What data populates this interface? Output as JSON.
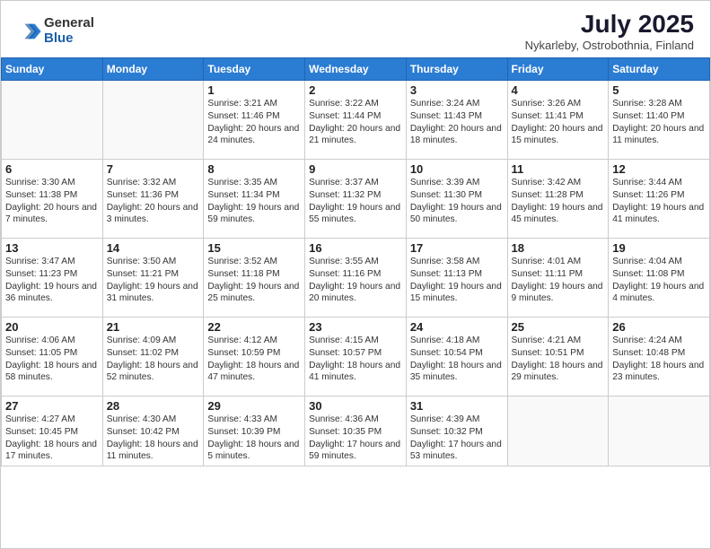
{
  "header": {
    "logo_general": "General",
    "logo_blue": "Blue",
    "month_title": "July 2025",
    "subtitle": "Nykarleby, Ostrobothnia, Finland"
  },
  "days_of_week": [
    "Sunday",
    "Monday",
    "Tuesday",
    "Wednesday",
    "Thursday",
    "Friday",
    "Saturday"
  ],
  "weeks": [
    [
      {
        "day": "",
        "info": ""
      },
      {
        "day": "",
        "info": ""
      },
      {
        "day": "1",
        "info": "Sunrise: 3:21 AM\nSunset: 11:46 PM\nDaylight: 20 hours\nand 24 minutes."
      },
      {
        "day": "2",
        "info": "Sunrise: 3:22 AM\nSunset: 11:44 PM\nDaylight: 20 hours\nand 21 minutes."
      },
      {
        "day": "3",
        "info": "Sunrise: 3:24 AM\nSunset: 11:43 PM\nDaylight: 20 hours\nand 18 minutes."
      },
      {
        "day": "4",
        "info": "Sunrise: 3:26 AM\nSunset: 11:41 PM\nDaylight: 20 hours\nand 15 minutes."
      },
      {
        "day": "5",
        "info": "Sunrise: 3:28 AM\nSunset: 11:40 PM\nDaylight: 20 hours\nand 11 minutes."
      }
    ],
    [
      {
        "day": "6",
        "info": "Sunrise: 3:30 AM\nSunset: 11:38 PM\nDaylight: 20 hours\nand 7 minutes."
      },
      {
        "day": "7",
        "info": "Sunrise: 3:32 AM\nSunset: 11:36 PM\nDaylight: 20 hours\nand 3 minutes."
      },
      {
        "day": "8",
        "info": "Sunrise: 3:35 AM\nSunset: 11:34 PM\nDaylight: 19 hours\nand 59 minutes."
      },
      {
        "day": "9",
        "info": "Sunrise: 3:37 AM\nSunset: 11:32 PM\nDaylight: 19 hours\nand 55 minutes."
      },
      {
        "day": "10",
        "info": "Sunrise: 3:39 AM\nSunset: 11:30 PM\nDaylight: 19 hours\nand 50 minutes."
      },
      {
        "day": "11",
        "info": "Sunrise: 3:42 AM\nSunset: 11:28 PM\nDaylight: 19 hours\nand 45 minutes."
      },
      {
        "day": "12",
        "info": "Sunrise: 3:44 AM\nSunset: 11:26 PM\nDaylight: 19 hours\nand 41 minutes."
      }
    ],
    [
      {
        "day": "13",
        "info": "Sunrise: 3:47 AM\nSunset: 11:23 PM\nDaylight: 19 hours\nand 36 minutes."
      },
      {
        "day": "14",
        "info": "Sunrise: 3:50 AM\nSunset: 11:21 PM\nDaylight: 19 hours\nand 31 minutes."
      },
      {
        "day": "15",
        "info": "Sunrise: 3:52 AM\nSunset: 11:18 PM\nDaylight: 19 hours\nand 25 minutes."
      },
      {
        "day": "16",
        "info": "Sunrise: 3:55 AM\nSunset: 11:16 PM\nDaylight: 19 hours\nand 20 minutes."
      },
      {
        "day": "17",
        "info": "Sunrise: 3:58 AM\nSunset: 11:13 PM\nDaylight: 19 hours\nand 15 minutes."
      },
      {
        "day": "18",
        "info": "Sunrise: 4:01 AM\nSunset: 11:11 PM\nDaylight: 19 hours\nand 9 minutes."
      },
      {
        "day": "19",
        "info": "Sunrise: 4:04 AM\nSunset: 11:08 PM\nDaylight: 19 hours\nand 4 minutes."
      }
    ],
    [
      {
        "day": "20",
        "info": "Sunrise: 4:06 AM\nSunset: 11:05 PM\nDaylight: 18 hours\nand 58 minutes."
      },
      {
        "day": "21",
        "info": "Sunrise: 4:09 AM\nSunset: 11:02 PM\nDaylight: 18 hours\nand 52 minutes."
      },
      {
        "day": "22",
        "info": "Sunrise: 4:12 AM\nSunset: 10:59 PM\nDaylight: 18 hours\nand 47 minutes."
      },
      {
        "day": "23",
        "info": "Sunrise: 4:15 AM\nSunset: 10:57 PM\nDaylight: 18 hours\nand 41 minutes."
      },
      {
        "day": "24",
        "info": "Sunrise: 4:18 AM\nSunset: 10:54 PM\nDaylight: 18 hours\nand 35 minutes."
      },
      {
        "day": "25",
        "info": "Sunrise: 4:21 AM\nSunset: 10:51 PM\nDaylight: 18 hours\nand 29 minutes."
      },
      {
        "day": "26",
        "info": "Sunrise: 4:24 AM\nSunset: 10:48 PM\nDaylight: 18 hours\nand 23 minutes."
      }
    ],
    [
      {
        "day": "27",
        "info": "Sunrise: 4:27 AM\nSunset: 10:45 PM\nDaylight: 18 hours\nand 17 minutes."
      },
      {
        "day": "28",
        "info": "Sunrise: 4:30 AM\nSunset: 10:42 PM\nDaylight: 18 hours\nand 11 minutes."
      },
      {
        "day": "29",
        "info": "Sunrise: 4:33 AM\nSunset: 10:39 PM\nDaylight: 18 hours\nand 5 minutes."
      },
      {
        "day": "30",
        "info": "Sunrise: 4:36 AM\nSunset: 10:35 PM\nDaylight: 17 hours\nand 59 minutes."
      },
      {
        "day": "31",
        "info": "Sunrise: 4:39 AM\nSunset: 10:32 PM\nDaylight: 17 hours\nand 53 minutes."
      },
      {
        "day": "",
        "info": ""
      },
      {
        "day": "",
        "info": ""
      }
    ]
  ]
}
